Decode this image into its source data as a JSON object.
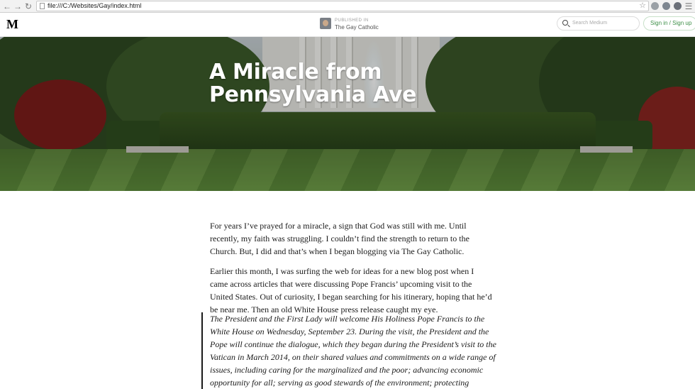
{
  "browser": {
    "url": "file:///C:/Websites/Gay/index.html"
  },
  "header": {
    "logo": "M",
    "publication_label": "PUBLISHED IN",
    "publication_name": "The Gay Catholic",
    "search_placeholder": "Search Medium",
    "signin_label": "Sign in / Sign up"
  },
  "hero": {
    "title": "A Miracle from Pennsylvania Ave"
  },
  "article": {
    "paragraphs": [
      "For years I’ve prayed for a miracle, a sign that God was still with me. Until recently, my faith was struggling. I couldn’t find the strength to return to the Church. But, I did and that’s when I began blogging via The Gay Catholic.",
      "Earlier this month, I was surfing the web for ideas for a new blog post when I came across articles that were discussing Pope Francis’ upcoming visit to the United States. Out of curiosity, I began searching for his itinerary, hoping that he’d be near me. Then an old White House press release caught my eye."
    ],
    "quote": "The President and the First Lady will welcome His Holiness Pope Francis to the White House on Wednesday, September 23. During the visit, the President and the Pope will continue the dialogue, which they began during the President’s visit to the Vatican in March 2014, on their shared values and commitments on a wide range of issues, including caring for the marginalized and the poor; advancing economic opportunity for all; serving as good stewards of the environment; protecting"
  },
  "colors": {
    "signin_green": "#3d8f47",
    "text": "#1a1a1a"
  }
}
